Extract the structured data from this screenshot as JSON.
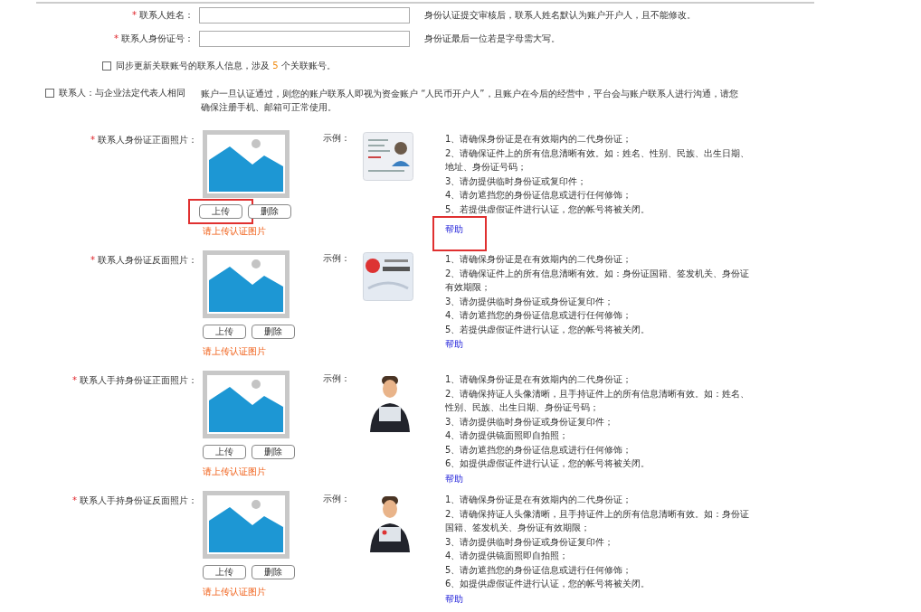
{
  "fields": [
    {
      "marker": "*",
      "label": "联系人姓名：",
      "hint": "身份认证提交审核后，联系人姓名默认为账户开户人，且不能修改。"
    },
    {
      "marker": "*",
      "label": "联系人身份证号：",
      "hint": "身份证最后一位若是字母需大写。"
    }
  ],
  "sync_option": {
    "checked": false,
    "text_before": "同步更新关联账号的联系人信息，涉及 ",
    "count": "5",
    "text_after": " 个关联账号。"
  },
  "legal_rep": {
    "checked": false,
    "label": "联系人：与企业法定代表人相同",
    "note": "账户一旦认证通过，则您的账户联系人即视为资金账户 “人民币开户人”，且账户在今后的经营中，平台会与账户联系人进行沟通，请您确保注册手机、邮箱可正常使用。"
  },
  "sections": [
    {
      "marker": "*",
      "label": "联系人身份证正面照片：",
      "upload": "上传",
      "delete": "删除",
      "error": "请上传认证图片",
      "example_label": "示例：",
      "kind": "card-front",
      "highlighted": true,
      "help": "帮助",
      "instructions": [
        "1、请确保身份证是在有效期内的二代身份证；",
        "2、请确保证件上的所有信息清晰有效。如：姓名、性别、民族、出生日期、地址、身份证号码；",
        "3、请勿提供临时身份证或复印件；",
        "4、请勿遮挡您的身份证信息或进行任何修饰；",
        "5、若提供虚假证件进行认证，您的帐号将被关闭。"
      ]
    },
    {
      "marker": "*",
      "label": "联系人身份证反面照片：",
      "upload": "上传",
      "delete": "删除",
      "error": "请上传认证图片",
      "example_label": "示例：",
      "kind": "card-back",
      "highlighted": false,
      "help": "帮助",
      "instructions": [
        "1、请确保身份证是在有效期内的二代身份证；",
        "2、请确保证件上的所有信息清晰有效。如：身份证国籍、签发机关、身份证有效期限；",
        "3、请勿提供临时身份证或身份证复印件；",
        "4、请勿遮挡您的身份证信息或进行任何修饰；",
        "5、若提供虚假证件进行认证，您的帐号将被关闭。"
      ]
    },
    {
      "marker": "*",
      "label": "联系人手持身份证正面照片：",
      "upload": "上传",
      "delete": "删除",
      "error": "请上传认证图片",
      "example_label": "示例：",
      "kind": "person-front",
      "highlighted": false,
      "help": "帮助",
      "instructions": [
        "1、请确保身份证是在有效期内的二代身份证；",
        "2、请确保持证人头像清晰，且手持证件上的所有信息清晰有效。如：姓名、性别、民族、出生日期、身份证号码；",
        "3、请勿提供临时身份证或身份证复印件；",
        "4、请勿提供镜面照即自拍照；",
        "5、请勿遮挡您的身份证信息或进行任何修饰；",
        "6、如提供虚假证件进行认证，您的帐号将被关闭。"
      ]
    },
    {
      "marker": "*",
      "label": "联系人手持身份证反面照片：",
      "upload": "上传",
      "delete": "删除",
      "error": "请上传认证图片",
      "example_label": "示例：",
      "kind": "person-back",
      "highlighted": false,
      "help": "帮助",
      "instructions": [
        "1、请确保身份证是在有效期内的二代身份证；",
        "2、请确保持证人头像清晰，且手持证件上的所有信息清晰有效。如：身份证国籍、签发机关、身份证有效期限；",
        "3、请勿提供临时身份证或身份证复印件；",
        "4、请勿提供镜面照即自拍照；",
        "5、请勿遮挡您的身份证信息或进行任何修饰；",
        "6、如提供虚假证件进行认证，您的帐号将被关闭。"
      ]
    }
  ]
}
